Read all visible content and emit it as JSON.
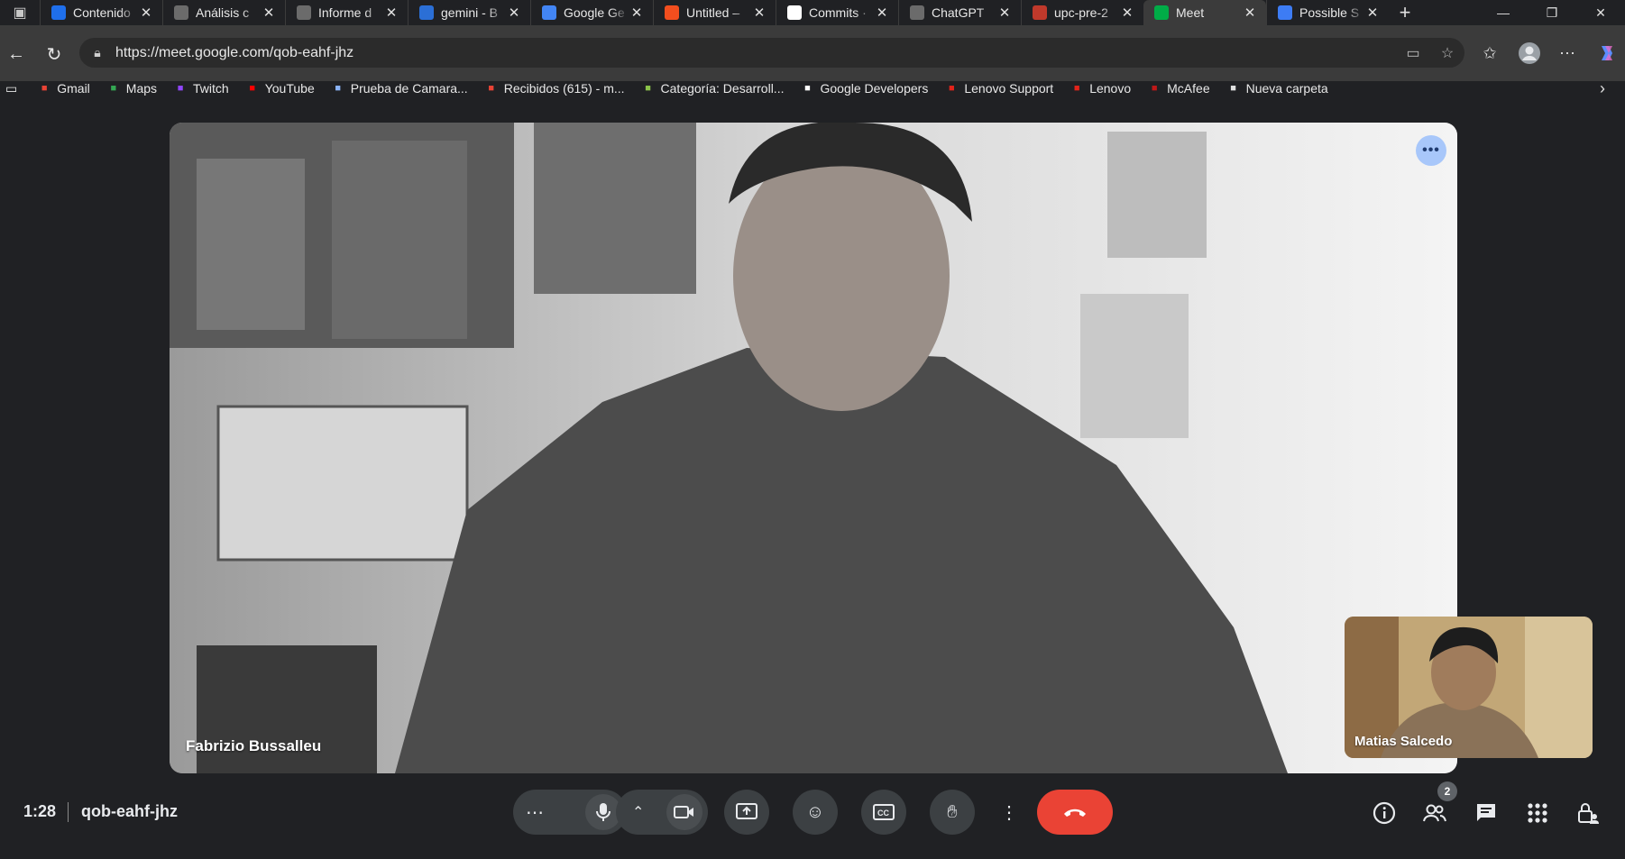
{
  "browser": {
    "tabs": [
      {
        "title": "Contenido",
        "favicon": "a-icon",
        "color": "#1f6feb"
      },
      {
        "title": "Análisis c",
        "favicon": "openai-icon",
        "color": "#6b6b6b"
      },
      {
        "title": "Informe d",
        "favicon": "openai-icon",
        "color": "#6b6b6b"
      },
      {
        "title": "gemini - B",
        "favicon": "search-icon",
        "color": "#2b6fd6"
      },
      {
        "title": "Google Ge",
        "favicon": "gemini-icon",
        "color": "#4285f4"
      },
      {
        "title": "Untitled –",
        "favicon": "figma-icon",
        "color": "#f24e1e"
      },
      {
        "title": "Commits ·",
        "favicon": "github-icon",
        "color": "#ffffff"
      },
      {
        "title": "ChatGPT",
        "favicon": "openai-icon",
        "color": "#6b6b6b"
      },
      {
        "title": "upc-pre-2",
        "favicon": "pdf-icon",
        "color": "#c0392b"
      },
      {
        "title": "Meet",
        "favicon": "meet-icon",
        "color": "#00ac47",
        "active": true
      },
      {
        "title": "Possible S",
        "favicon": "copilot-icon",
        "color": "#3d7cf4"
      }
    ],
    "url": "https://meet.google.com/qob-eahf-jhz",
    "bookmarks": [
      {
        "label": "Gmail",
        "icon": "gmail-icon",
        "color": "#ea4335"
      },
      {
        "label": "Maps",
        "icon": "maps-icon",
        "color": "#34a853"
      },
      {
        "label": "Twitch",
        "icon": "twitch-icon",
        "color": "#9146ff"
      },
      {
        "label": "YouTube",
        "icon": "youtube-icon",
        "color": "#ff0000"
      },
      {
        "label": "Prueba de Camara...",
        "icon": "globe-icon",
        "color": "#8ab4f8"
      },
      {
        "label": "Recibidos (615) - m...",
        "icon": "gmail-icon",
        "color": "#ea4335"
      },
      {
        "label": "Categoría: Desarroll...",
        "icon": "diamond-icon",
        "color": "#8bc34a"
      },
      {
        "label": "Google Developers",
        "icon": "google-icon",
        "color": "#ffffff"
      },
      {
        "label": "Lenovo Support",
        "icon": "lenovo-icon",
        "color": "#e2231a"
      },
      {
        "label": "Lenovo",
        "icon": "lenovo-icon",
        "color": "#e2231a"
      },
      {
        "label": "McAfee",
        "icon": "mcafee-icon",
        "color": "#c01818"
      },
      {
        "label": "Nueva carpeta",
        "icon": "folder-icon",
        "color": "#e0e0e0"
      }
    ]
  },
  "meet": {
    "main_participant": "Fabrizio Bussalleu",
    "self_participant": "Matias Salcedo",
    "time": "1:28",
    "meeting_code": "qob-eahf-jhz",
    "participant_count": "2",
    "end_call_color": "#ea4335"
  }
}
